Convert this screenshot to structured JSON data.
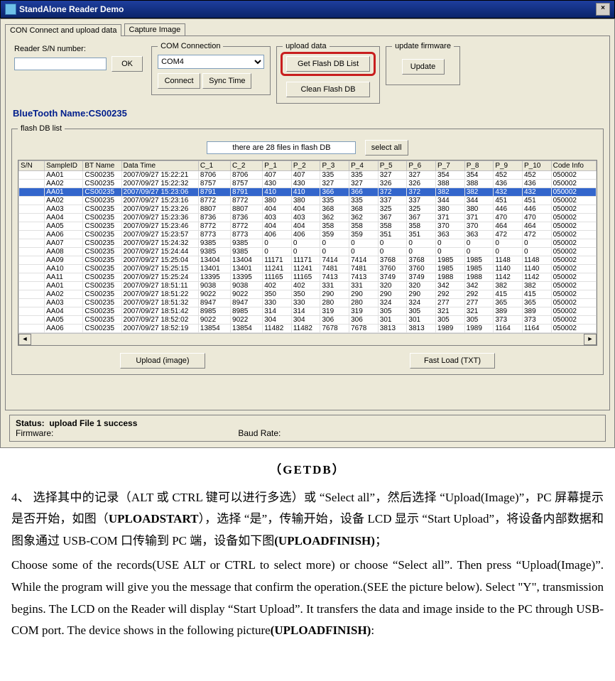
{
  "window": {
    "title": "StandAlone Reader Demo",
    "close_icon": "×"
  },
  "tabs": [
    "CON Connect and upload data",
    "Capture Image"
  ],
  "reader_group": {
    "label": "Reader S/N number:",
    "value": "",
    "ok": "OK"
  },
  "com_group": {
    "legend": "COM Connection",
    "port": "COM4",
    "connect": "Connect",
    "sync": "Sync Time"
  },
  "upload_group": {
    "legend": "upload data",
    "get": "Get Flash DB List",
    "clean": "Clean Flash DB"
  },
  "update_group": {
    "legend": "update firmware",
    "update": "Update"
  },
  "bt_row": {
    "label": "BlueTooth Name:",
    "value": "CS00235"
  },
  "flash_group": {
    "legend": "flash DB list",
    "info": "there are 28 files in flash DB",
    "select_all": "select all"
  },
  "table": {
    "headers": [
      "S/N",
      "SampleID",
      "BT Name",
      "Data Time",
      "C_1",
      "C_2",
      "P_1",
      "P_2",
      "P_3",
      "P_4",
      "P_5",
      "P_6",
      "P_7",
      "P_8",
      "P_9",
      "P_10",
      "Code Info"
    ],
    "rows": [
      {
        "sel": false,
        "cells": [
          "",
          "AA01",
          "CS00235",
          "2007/09/27 15:22:21",
          "8706",
          "8706",
          "407",
          "407",
          "335",
          "335",
          "327",
          "327",
          "354",
          "354",
          "452",
          "452",
          "050002"
        ]
      },
      {
        "sel": false,
        "cells": [
          "",
          "AA02",
          "CS00235",
          "2007/09/27 15:22:32",
          "8757",
          "8757",
          "430",
          "430",
          "327",
          "327",
          "326",
          "326",
          "388",
          "388",
          "436",
          "436",
          "050002"
        ]
      },
      {
        "sel": true,
        "cells": [
          "",
          "AA01",
          "CS00235",
          "2007/09/27 15:23:06",
          "8791",
          "8791",
          "410",
          "410",
          "366",
          "366",
          "372",
          "372",
          "382",
          "382",
          "432",
          "432",
          "050002"
        ]
      },
      {
        "sel": false,
        "cells": [
          "",
          "AA02",
          "CS00235",
          "2007/09/27 15:23:16",
          "8772",
          "8772",
          "380",
          "380",
          "335",
          "335",
          "337",
          "337",
          "344",
          "344",
          "451",
          "451",
          "050002"
        ]
      },
      {
        "sel": false,
        "cells": [
          "",
          "AA03",
          "CS00235",
          "2007/09/27 15:23:26",
          "8807",
          "8807",
          "404",
          "404",
          "368",
          "368",
          "325",
          "325",
          "380",
          "380",
          "446",
          "446",
          "050002"
        ]
      },
      {
        "sel": false,
        "cells": [
          "",
          "AA04",
          "CS00235",
          "2007/09/27 15:23:36",
          "8736",
          "8736",
          "403",
          "403",
          "362",
          "362",
          "367",
          "367",
          "371",
          "371",
          "470",
          "470",
          "050002"
        ]
      },
      {
        "sel": false,
        "cells": [
          "",
          "AA05",
          "CS00235",
          "2007/09/27 15:23:46",
          "8772",
          "8772",
          "404",
          "404",
          "358",
          "358",
          "358",
          "358",
          "370",
          "370",
          "464",
          "464",
          "050002"
        ]
      },
      {
        "sel": false,
        "cells": [
          "",
          "AA06",
          "CS00235",
          "2007/09/27 15:23:57",
          "8773",
          "8773",
          "406",
          "406",
          "359",
          "359",
          "351",
          "351",
          "363",
          "363",
          "472",
          "472",
          "050002"
        ]
      },
      {
        "sel": false,
        "cells": [
          "",
          "AA07",
          "CS00235",
          "2007/09/27 15:24:32",
          "9385",
          "9385",
          "0",
          "0",
          "0",
          "0",
          "0",
          "0",
          "0",
          "0",
          "0",
          "0",
          "050002"
        ]
      },
      {
        "sel": false,
        "cells": [
          "",
          "AA08",
          "CS00235",
          "2007/09/27 15:24:44",
          "9385",
          "9385",
          "0",
          "0",
          "0",
          "0",
          "0",
          "0",
          "0",
          "0",
          "0",
          "0",
          "050002"
        ]
      },
      {
        "sel": false,
        "cells": [
          "",
          "AA09",
          "CS00235",
          "2007/09/27 15:25:04",
          "13404",
          "13404",
          "11171",
          "11171",
          "7414",
          "7414",
          "3768",
          "3768",
          "1985",
          "1985",
          "1148",
          "1148",
          "050002"
        ]
      },
      {
        "sel": false,
        "cells": [
          "",
          "AA10",
          "CS00235",
          "2007/09/27 15:25:15",
          "13401",
          "13401",
          "11241",
          "11241",
          "7481",
          "7481",
          "3760",
          "3760",
          "1985",
          "1985",
          "1140",
          "1140",
          "050002"
        ]
      },
      {
        "sel": false,
        "cells": [
          "",
          "AA11",
          "CS00235",
          "2007/09/27 15:25:24",
          "13395",
          "13395",
          "11165",
          "11165",
          "7413",
          "7413",
          "3749",
          "3749",
          "1988",
          "1988",
          "1142",
          "1142",
          "050002"
        ]
      },
      {
        "sel": false,
        "cells": [
          "",
          "AA01",
          "CS00235",
          "2007/09/27 18:51:11",
          "9038",
          "9038",
          "402",
          "402",
          "331",
          "331",
          "320",
          "320",
          "342",
          "342",
          "382",
          "382",
          "050002"
        ]
      },
      {
        "sel": false,
        "cells": [
          "",
          "AA02",
          "CS00235",
          "2007/09/27 18:51:22",
          "9022",
          "9022",
          "350",
          "350",
          "290",
          "290",
          "290",
          "290",
          "292",
          "292",
          "415",
          "415",
          "050002"
        ]
      },
      {
        "sel": false,
        "cells": [
          "",
          "AA03",
          "CS00235",
          "2007/09/27 18:51:32",
          "8947",
          "8947",
          "330",
          "330",
          "280",
          "280",
          "324",
          "324",
          "277",
          "277",
          "365",
          "365",
          "050002"
        ]
      },
      {
        "sel": false,
        "cells": [
          "",
          "AA04",
          "CS00235",
          "2007/09/27 18:51:42",
          "8985",
          "8985",
          "314",
          "314",
          "319",
          "319",
          "305",
          "305",
          "321",
          "321",
          "389",
          "389",
          "050002"
        ]
      },
      {
        "sel": false,
        "cells": [
          "",
          "AA05",
          "CS00235",
          "2007/09/27 18:52:02",
          "9022",
          "9022",
          "304",
          "304",
          "306",
          "306",
          "301",
          "301",
          "305",
          "305",
          "373",
          "373",
          "050002"
        ]
      },
      {
        "sel": false,
        "cells": [
          "",
          "AA06",
          "CS00235",
          "2007/09/27 18:52:19",
          "13854",
          "13854",
          "11482",
          "11482",
          "7678",
          "7678",
          "3813",
          "3813",
          "1989",
          "1989",
          "1164",
          "1164",
          "050002"
        ]
      }
    ]
  },
  "load_buttons": {
    "upload_image": "Upload (image)",
    "fast_load": "Fast Load (TXT)"
  },
  "status": {
    "status_label": "Status:",
    "status_value": "upload File 1 success",
    "firmware_label": "Firmware:",
    "baud_label": "Baud Rate:"
  },
  "doc": {
    "title": "（GETDB）",
    "cn": "4、 选择其中的记录（ALT 或 CTRL 键可以进行多选）或 “Select all”，然后选择 “Upload(Image)”，PC 屏幕提示是否开始，如图（UPLOADSTART），选择 “是”，传输开始，设备 LCD 显示 “Start Upload”，将设备内部数据和图象通过 USB-COM 口传输到 PC 端，设备如下图(UPLOADFINISH)；",
    "en1": "Choose some of the records(USE ALT or CTRL to select more) or choose “Select all”. Then press  “Upload(Image)”. While the program will give you the message that confirm the operation.(SEE the picture below). Select \"Y\", transmission begins. The LCD on the Reader will display  “Start Upload”. It transfers the data and image inside to the PC through USB-COM port. The device shows in the following picture",
    "en_bold": "(UPLOADFINISH)",
    "en_tail": ":"
  }
}
